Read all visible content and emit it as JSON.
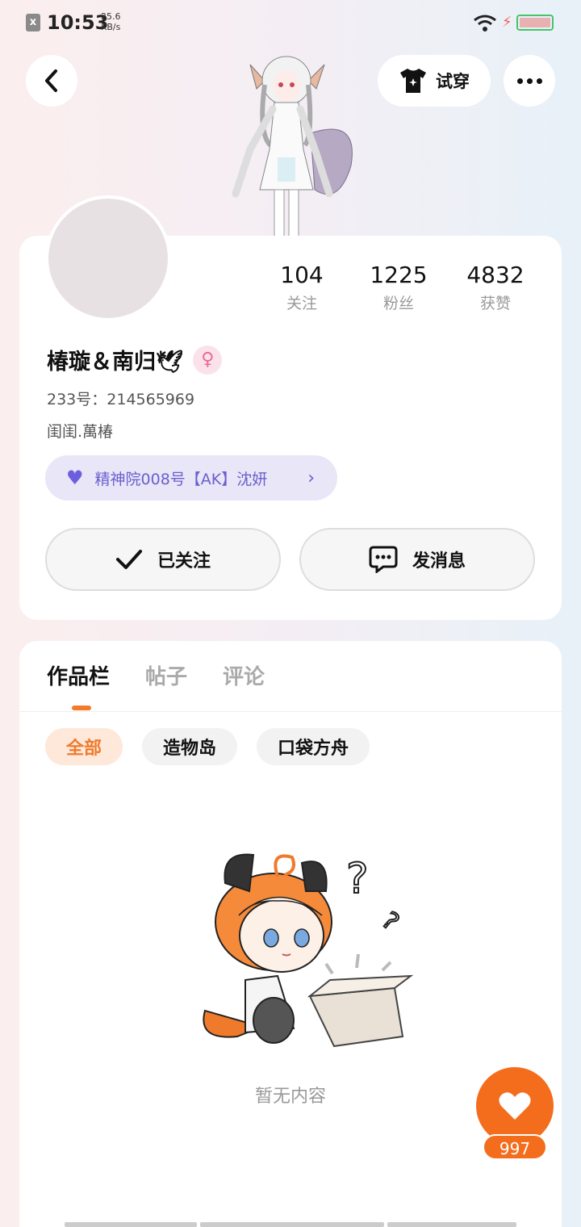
{
  "status_bar": {
    "time": "10:53",
    "speed_value": "25.6",
    "speed_unit": "KB/s",
    "close_glyph": "x"
  },
  "header": {
    "tryon_label": "试穿",
    "tryon_icon": "tshirt-icon",
    "back_icon": "chevron-left-icon",
    "more_icon": "more-dots-icon"
  },
  "profile": {
    "stats": [
      {
        "value": "104",
        "label": "关注"
      },
      {
        "value": "1225",
        "label": "粉丝"
      },
      {
        "value": "4832",
        "label": "获赞"
      }
    ],
    "username": "椿璇＆南归🕊",
    "gender_symbol": "♀",
    "uid": "233号：214565969",
    "bio": "闺闺.萬椿",
    "guild": "精神院008号【AK】沈妍",
    "follow_label": "已关注",
    "message_label": "发消息"
  },
  "tabs": [
    {
      "label": "作品栏",
      "active": true
    },
    {
      "label": "帖子",
      "active": false
    },
    {
      "label": "评论",
      "active": false
    }
  ],
  "filters": [
    {
      "label": "全部",
      "active": true
    },
    {
      "label": "造物岛",
      "active": false
    },
    {
      "label": "口袋方舟",
      "active": false
    }
  ],
  "empty_state": {
    "text": "暂无内容"
  },
  "like_fab": {
    "count": "997"
  },
  "colors": {
    "accent": "#f36d1c",
    "guild_bg": "#e8e6f7",
    "guild_text": "#6b5fce"
  }
}
